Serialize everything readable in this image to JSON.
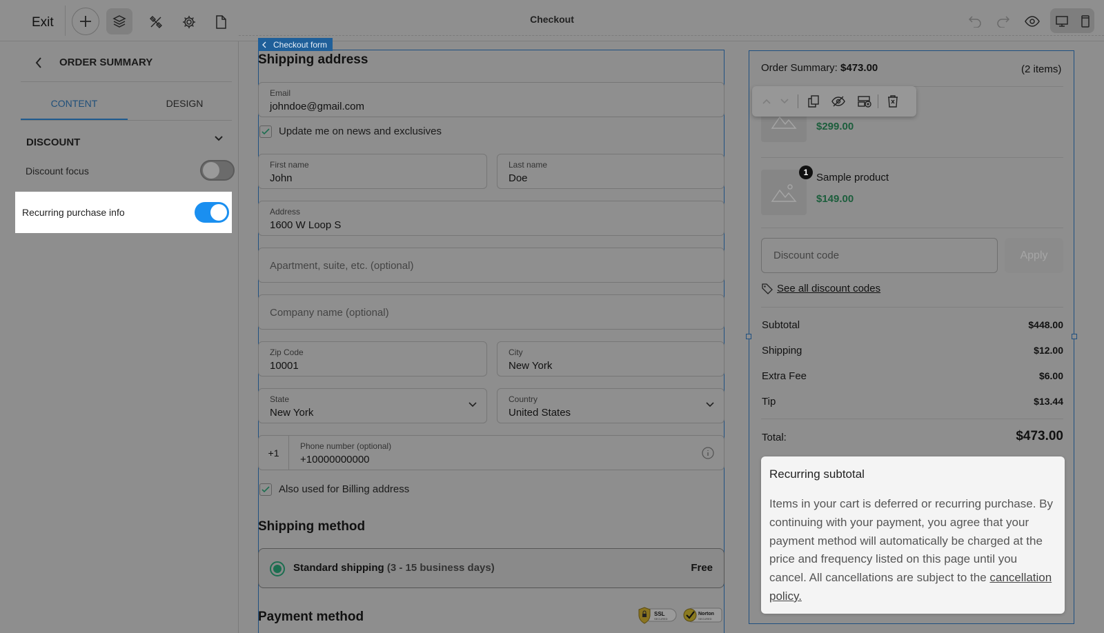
{
  "topbar": {
    "exit_label": "Exit",
    "page_title": "Checkout"
  },
  "left_panel": {
    "title": "ORDER SUMMARY",
    "tabs": [
      {
        "label": "CONTENT",
        "active": true
      },
      {
        "label": "DESIGN",
        "active": false
      }
    ],
    "section_title": "DISCOUNT",
    "options": [
      {
        "label": "Discount focus",
        "enabled": false
      },
      {
        "label": "Recurring purchase info",
        "enabled": true
      }
    ]
  },
  "form": {
    "tag_label": "Checkout form",
    "shipping_heading": "Shipping address",
    "email": {
      "label": "Email",
      "value": "johndoe@gmail.com"
    },
    "news_checkbox": {
      "label": "Update me on news and exclusives",
      "checked": true
    },
    "first_name": {
      "label": "First name",
      "value": "John"
    },
    "last_name": {
      "label": "Last name",
      "value": "Doe"
    },
    "address": {
      "label": "Address",
      "value": "1600 W Loop S"
    },
    "apartment_placeholder": "Apartment, suite, etc. (optional)",
    "company_placeholder": "Company name (optional)",
    "zip": {
      "label": "Zip Code",
      "value": "10001"
    },
    "city": {
      "label": "City",
      "value": "New York"
    },
    "state": {
      "label": "State",
      "value": "New York"
    },
    "country": {
      "label": "Country",
      "value": "United States"
    },
    "phone": {
      "prefix": "+1",
      "label": "Phone number (optional)",
      "value": "+10000000000"
    },
    "billing_checkbox": {
      "label": "Also used for Billing address",
      "checked": true
    },
    "shipping_method_heading": "Shipping method",
    "shipping_option": {
      "name": "Standard shipping",
      "days": "(3 - 15 business days)",
      "price": "Free",
      "selected": true
    },
    "payment_heading": "Payment method",
    "badges": {
      "ssl": "SSL",
      "ssl_sub": "SECURED",
      "norton": "Norton",
      "norton_sub": "SECURED"
    }
  },
  "order_summary": {
    "title_label": "Order Summary:",
    "title_amount": "$473.00",
    "items_count": "(2 items)",
    "products": [
      {
        "name": "",
        "price": "$299.00",
        "qty": ""
      },
      {
        "name": "Sample product",
        "price": "$149.00",
        "qty": "1"
      }
    ],
    "discount_placeholder": "Discount code",
    "apply_label": "Apply",
    "see_codes_label": "See all discount codes",
    "rows": [
      {
        "label": "Subtotal",
        "value": "$448.00"
      },
      {
        "label": "Shipping",
        "value": "$12.00"
      },
      {
        "label": "Extra Fee",
        "value": "$6.00"
      },
      {
        "label": "Tip",
        "value": "$13.44"
      }
    ],
    "total_label": "Total:",
    "total_value": "$473.00",
    "recurring": {
      "title": "Recurring subtotal",
      "body": "Items in your cart is deferred or recurring purchase. By continuing with your payment, you agree that your payment method will automatically be charged at the price and frequency listed on this page until you cancel. All cancellations are subject to the",
      "link": "cancellation policy."
    }
  },
  "colors": {
    "accent": "#1a8ff0",
    "selection": "#1e4f80",
    "price_green": "#1c5e3c"
  }
}
